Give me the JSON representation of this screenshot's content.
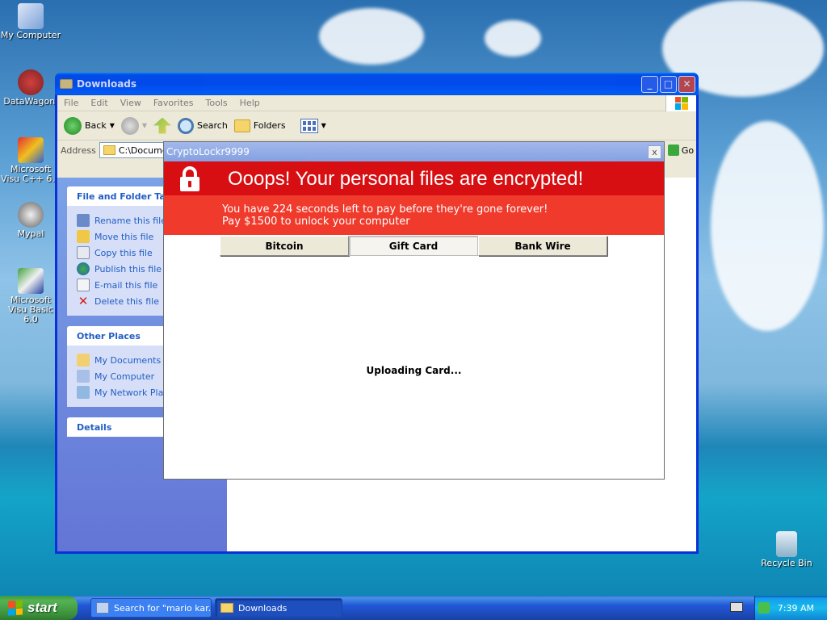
{
  "desktop": {
    "icons": [
      {
        "label": "My Computer",
        "icon": "my-computer-icon"
      },
      {
        "label": "DataWagon.",
        "icon": "datawagon-icon"
      },
      {
        "label": "Microsoft Visu C++ 6.0",
        "icon": "msvc-icon"
      },
      {
        "label": "Mypal",
        "icon": "mypal-icon"
      },
      {
        "label": "Microsoft Visu Basic 6.0",
        "icon": "vb6-icon"
      },
      {
        "label": "Recycle Bin",
        "icon": "recycle-bin-icon"
      }
    ]
  },
  "explorer": {
    "title": "Downloads",
    "menu": [
      "File",
      "Edit",
      "View",
      "Favorites",
      "Tools",
      "Help"
    ],
    "toolbar": {
      "back": "Back",
      "search": "Search",
      "folders": "Folders"
    },
    "address_label": "Address",
    "address_value": "C:\\Documen",
    "go_label": "Go",
    "tasks_panel": {
      "title": "File and Folder Task",
      "items": [
        "Rename this file",
        "Move this file",
        "Copy this file",
        "Publish this file to",
        "E-mail this file",
        "Delete this file"
      ]
    },
    "places_panel": {
      "title": "Other Places",
      "items": [
        "My Documents",
        "My Computer",
        "My Network Place"
      ]
    },
    "details_panel": {
      "title": "Details"
    }
  },
  "ransom": {
    "title": "CryptoLockr9999",
    "close_glyph": "x",
    "headline": "Ooops! Your personal files are encrypted!",
    "line1": "You have 224 seconds left to pay before they're gone forever!",
    "line2": "Pay $1500 to unlock your computer",
    "tabs": [
      "Bitcoin",
      "Gift Card",
      "Bank Wire"
    ],
    "selected_tab": "Gift Card",
    "status": "Uploading Card..."
  },
  "taskbar": {
    "start_label": "start",
    "tasks": [
      "Search for \"mario kar...",
      "Downloads"
    ],
    "clock": "7:39 AM"
  },
  "colors": {
    "banner_red": "#d80f12",
    "sub_banner_red": "#f03a2c",
    "xp_blue": "#0831d9"
  }
}
